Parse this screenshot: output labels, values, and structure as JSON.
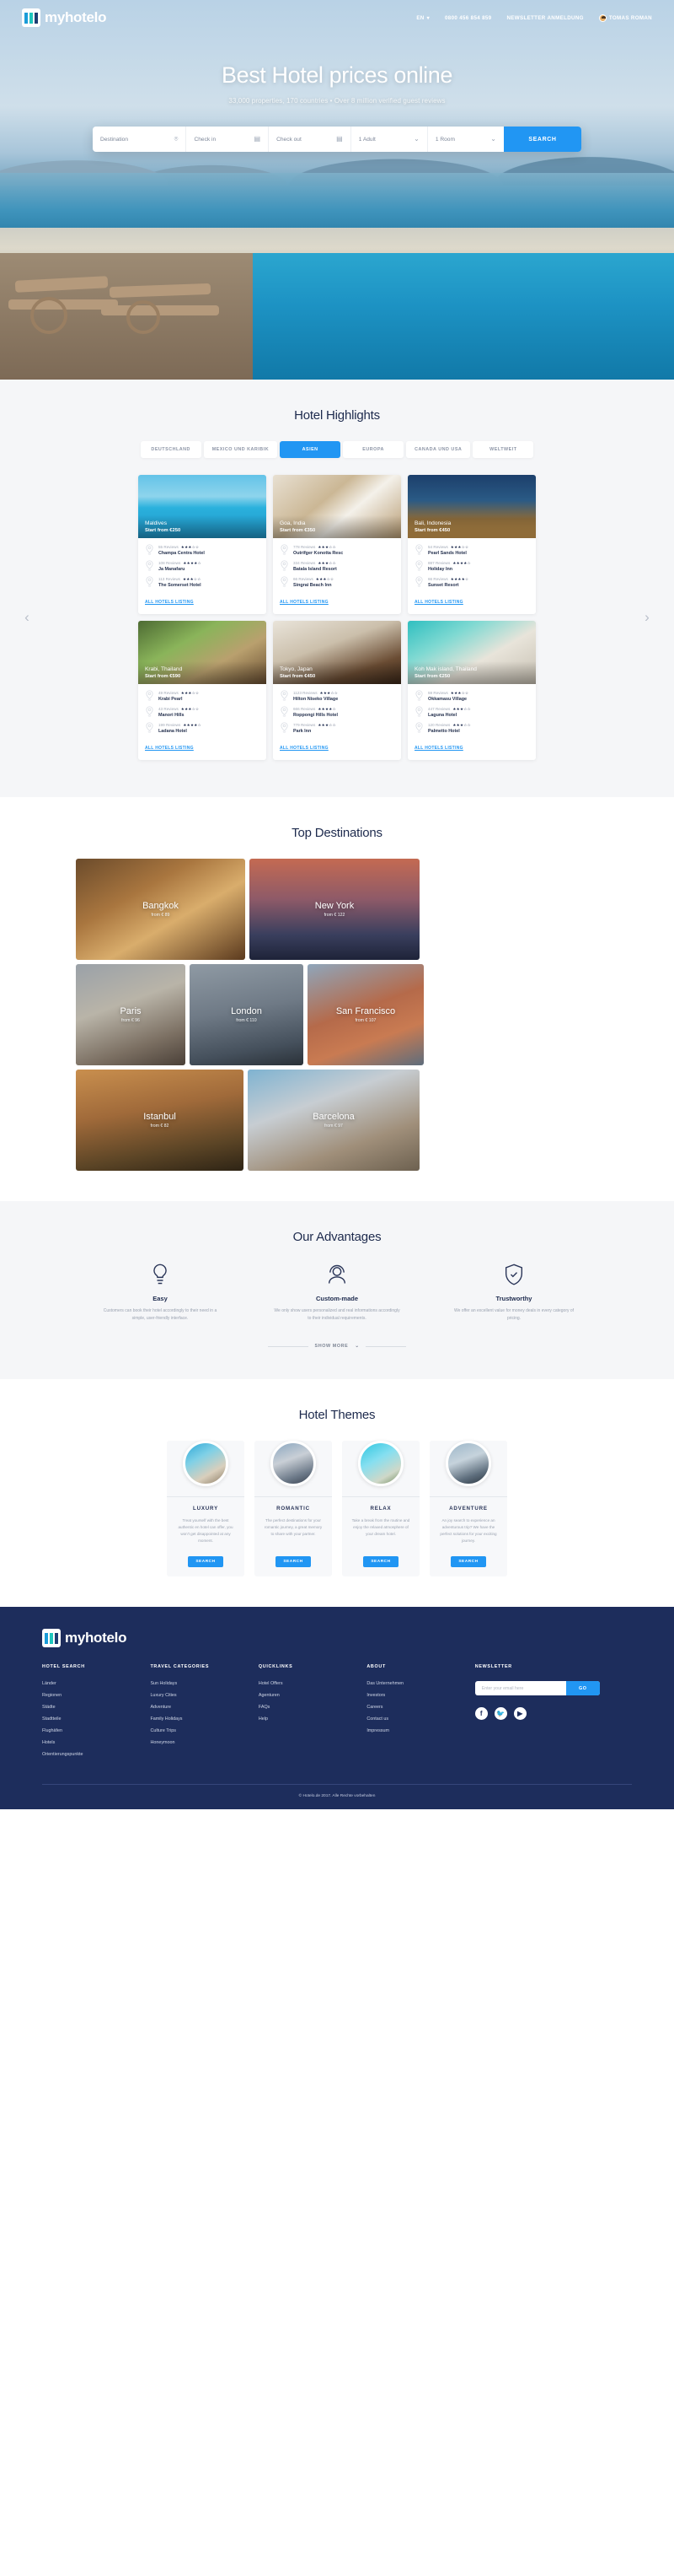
{
  "header": {
    "brand": "myhotelo",
    "lang": "EN",
    "phone": "0800 456 854 859",
    "newsletter_link": "NEWSLETTER ANMELDUNG",
    "user": "TOMAS ROMAN"
  },
  "hero": {
    "title": "Best Hotel prices online",
    "subtitle": "33,000 properties, 170 countries • Over 8 million verified guest reviews",
    "search": {
      "destination_placeholder": "Destination",
      "checkin_placeholder": "Check in",
      "checkout_placeholder": "Check out",
      "guests_value": "1 Adult",
      "rooms_value": "1 Room",
      "button": "SEARCH"
    }
  },
  "highlights": {
    "title": "Hotel Highlights",
    "tabs": [
      {
        "label": "DEUTSCHLAND",
        "active": false
      },
      {
        "label": "MEXICO UND KARIBIK",
        "active": false
      },
      {
        "label": "ASIEN",
        "active": true
      },
      {
        "label": "EUROPA",
        "active": false
      },
      {
        "label": "CANADA UND USA",
        "active": false
      },
      {
        "label": "WELTWEIT",
        "active": false
      }
    ],
    "all_link": "ALL HOTELS LISTING",
    "cards": [
      {
        "location": "Maldives",
        "price": "Start from €250",
        "img": "img-maldives",
        "hotels": [
          {
            "reviews": "55 Reviews",
            "stars": "★★★☆☆",
            "name": "Champa Centra Hotel"
          },
          {
            "reviews": "108 Reviews",
            "stars": "★★★★☆",
            "name": "Ja Manafaru"
          },
          {
            "reviews": "113 Reviews",
            "stars": "★★★☆☆",
            "name": "The Somerset Hotel"
          }
        ]
      },
      {
        "location": "Goa, India",
        "price": "Start from €350",
        "img": "img-goa",
        "hotels": [
          {
            "reviews": "778 Reviews",
            "stars": "★★★☆☆",
            "name": "Outrifger Konotta Resc"
          },
          {
            "reviews": "334 Reviews",
            "stars": "★★★☆☆",
            "name": "Batala Island Resort"
          },
          {
            "reviews": "66 Reviews",
            "stars": "★★★☆☆",
            "name": "Singrai Beach Inn"
          }
        ]
      },
      {
        "location": "Bali, Indonesia",
        "price": "Start from €450",
        "img": "img-bali",
        "hotels": [
          {
            "reviews": "54 Reviews",
            "stars": "★★★☆☆",
            "name": "Pearl Sands Hotel"
          },
          {
            "reviews": "887 Reviews",
            "stars": "★★★★☆",
            "name": "Holiday Inn"
          },
          {
            "reviews": "66 Reviews",
            "stars": "★★★★☆",
            "name": "Sunset Resort"
          }
        ]
      },
      {
        "location": "Krabi, Thailand",
        "price": "Start from €590",
        "img": "img-krabi",
        "hotels": [
          {
            "reviews": "49 Reviews",
            "stars": "★★★☆☆",
            "name": "Krabi Pearl"
          },
          {
            "reviews": "43 Reviews",
            "stars": "★★★☆☆",
            "name": "Manori Hills"
          },
          {
            "reviews": "199 Reviews",
            "stars": "★★★★☆",
            "name": "Ladana Hotel"
          }
        ]
      },
      {
        "location": "Tokyo, Japan",
        "price": "Start from €450",
        "img": "img-tokyo",
        "hotels": [
          {
            "reviews": "1123 Reviews",
            "stars": "★★★☆☆",
            "name": "Hilton Niseko Village"
          },
          {
            "reviews": "666 Reviews",
            "stars": "★★★★☆",
            "name": "Roppongi Hills Hotel"
          },
          {
            "reviews": "779 Reviews",
            "stars": "★★★☆☆",
            "name": "Park Inn"
          }
        ]
      },
      {
        "location": "Koh Mak island, Thailand",
        "price": "Start from €250",
        "img": "img-kohmak",
        "hotels": [
          {
            "reviews": "59 Reviews",
            "stars": "★★★☆☆",
            "name": "Okkamasu Village"
          },
          {
            "reviews": "447 Reviews",
            "stars": "★★★☆☆",
            "name": "Laguna Hotel"
          },
          {
            "reviews": "120 Reviews",
            "stars": "★★★☆☆",
            "name": "Palmetto Hotel"
          }
        ]
      }
    ]
  },
  "destinations": {
    "title": "Top Destinations",
    "items": [
      {
        "name": "Bangkok",
        "from": "from € 89",
        "cls": "d-bangkok"
      },
      {
        "name": "New York",
        "from": "from € 122",
        "cls": "d-newyork"
      },
      {
        "name": "Paris",
        "from": "from € 96",
        "cls": "d-paris"
      },
      {
        "name": "London",
        "from": "from € 110",
        "cls": "d-london"
      },
      {
        "name": "San Francisco",
        "from": "from € 107",
        "cls": "d-sanfran"
      },
      {
        "name": "Istanbul",
        "from": "from € 82",
        "cls": "d-istanbul"
      },
      {
        "name": "Barcelona",
        "from": "from € 97",
        "cls": "d-barcelona"
      }
    ]
  },
  "advantages": {
    "title": "Our Advantages",
    "items": [
      {
        "icon": "lightbulb-icon",
        "title": "Easy",
        "desc": "Customers can book their hotel accordingly to their need in a simple, user-friendly interface."
      },
      {
        "icon": "user-headset-icon",
        "title": "Custom-made",
        "desc": "We only show users personalized and real informations accordingly to their individual requirements."
      },
      {
        "icon": "shield-icon",
        "title": "Trustworthy",
        "desc": "We offer an excellent value for money deals in every category of pricing."
      }
    ],
    "show_more": "SHOW MORE"
  },
  "themes": {
    "title": "Hotel Themes",
    "button_label": "SEARCH",
    "items": [
      {
        "name": "LUXURY",
        "cls": "t1",
        "desc": "Treat yourself with the best authentic en hotel can offer, you won't get disappointed at any moment."
      },
      {
        "name": "ROMANTIC",
        "cls": "t2",
        "desc": "The perfect destinations for your romantic journey, a great memory to share with your partner."
      },
      {
        "name": "RELAX",
        "cls": "t3",
        "desc": "Take a break from the routine and enjoy the relaxed atmosphere of your dream hotel."
      },
      {
        "name": "ADVENTURE",
        "cls": "t4",
        "desc": "An joy search to experience an adventurous trip? We have the perfect solutions for your exciting journey."
      }
    ]
  },
  "footer": {
    "brand": "myhotelo",
    "columns": [
      {
        "heading": "HOTEL SEARCH",
        "links": [
          "Länder",
          "Regionen",
          "Städte",
          "Stadtteile",
          "Flughäfen",
          "Hotels",
          "Orientierungspunkte"
        ]
      },
      {
        "heading": "TRAVEL CATEGORIES",
        "links": [
          "Sun Holidays",
          "Luxury Cities",
          "Adventure",
          "Family Holidays",
          "Culture Trips",
          "Honeymoon"
        ]
      },
      {
        "heading": "QUICKLINKS",
        "links": [
          "Hotel Offers",
          "Agenturen",
          "FAQs",
          "Help"
        ]
      },
      {
        "heading": "ABOUT",
        "links": [
          "Das Unternehmen",
          "Investors",
          "Careers",
          "Contact us",
          "Impressum"
        ]
      }
    ],
    "newsletter": {
      "heading": "NEWSLETTER",
      "placeholder": "Enter your email here",
      "button": "GO"
    },
    "socials": [
      "facebook-icon",
      "twitter-icon",
      "youtube-icon"
    ],
    "copyright": "© Hotelo.de 2017.  Alle Rechte vorbehalten"
  },
  "colors": {
    "accent": "#2196f3",
    "footer_bg": "#1d2d5c",
    "text_dark": "#1d2a4d"
  }
}
